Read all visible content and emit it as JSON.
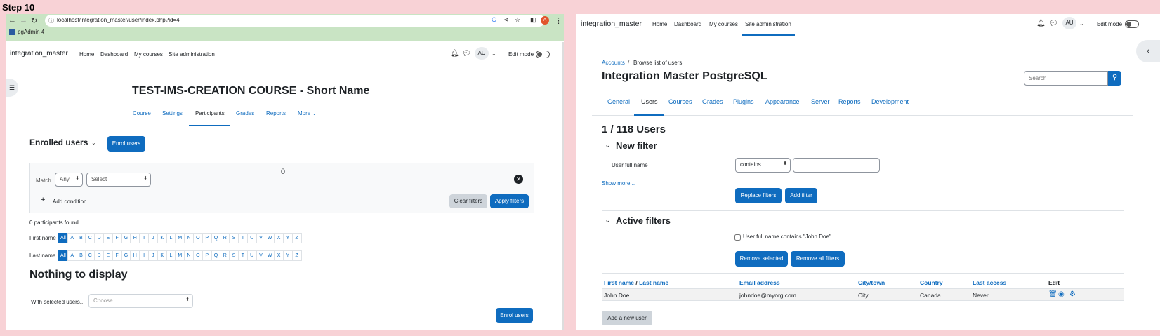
{
  "step": "Step 10",
  "left": {
    "url": "localhost/integration_master/user/index.php?id=4",
    "bookmark": "pgAdmin 4",
    "site": "integration_master",
    "nav": [
      "Home",
      "Dashboard",
      "My courses",
      "Site administration"
    ],
    "avatar": "AU",
    "edit_mode": "Edit mode",
    "course_title": "TEST-IMS-CREATION COURSE - Short Name",
    "course_tabs": [
      "Course",
      "Settings",
      "Participants",
      "Grades",
      "Reports",
      "More"
    ],
    "enrolled_label": "Enrolled users",
    "enrol_button": "Enrol users",
    "zero": "0",
    "match_label": "Match",
    "match_value": "Any",
    "select_value": "Select",
    "add_condition": "Add condition",
    "clear_filters": "Clear filters",
    "apply_filters": "Apply filters",
    "participants_found": "0 participants found",
    "first_name": "First name",
    "last_name": "Last name",
    "letters": [
      "All",
      "A",
      "B",
      "C",
      "D",
      "E",
      "F",
      "G",
      "H",
      "I",
      "J",
      "K",
      "L",
      "M",
      "N",
      "O",
      "P",
      "Q",
      "R",
      "S",
      "T",
      "U",
      "V",
      "W",
      "X",
      "Y",
      "Z"
    ],
    "nothing": "Nothing to display",
    "with_selected": "With selected users...",
    "choose": "Choose...",
    "enrol_button2": "Enrol users"
  },
  "right": {
    "site": "integration_master",
    "nav": [
      "Home",
      "Dashboard",
      "My courses",
      "Site administration"
    ],
    "avatar": "AU",
    "edit_mode": "Edit mode",
    "breadcrumb": [
      "Accounts",
      "Browse list of users"
    ],
    "title": "Integration Master PostgreSQL",
    "search_placeholder": "Search",
    "tabs": [
      "General",
      "Users",
      "Courses",
      "Grades",
      "Plugins",
      "Appearance",
      "Server",
      "Reports",
      "Development"
    ],
    "count": "1 / 118 Users",
    "new_filter": "New filter",
    "user_full_name": "User full name",
    "contains": "contains",
    "show_more": "Show more...",
    "replace_filters": "Replace filters",
    "add_filter": "Add filter",
    "active_filters": "Active filters",
    "active_filter_item": "User full name contains \"John Doe\"",
    "remove_selected": "Remove selected",
    "remove_all": "Remove all filters",
    "headers": {
      "first": "First name",
      "sep": " / ",
      "last": "Last name",
      "email": "Email address",
      "city": "City/town",
      "country": "Country",
      "access": "Last access",
      "edit": "Edit"
    },
    "row": {
      "name": "John Doe",
      "email": "johndoe@myorg.com",
      "city": "City",
      "country": "Canada",
      "access": "Never"
    },
    "add_user": "Add a new user"
  }
}
